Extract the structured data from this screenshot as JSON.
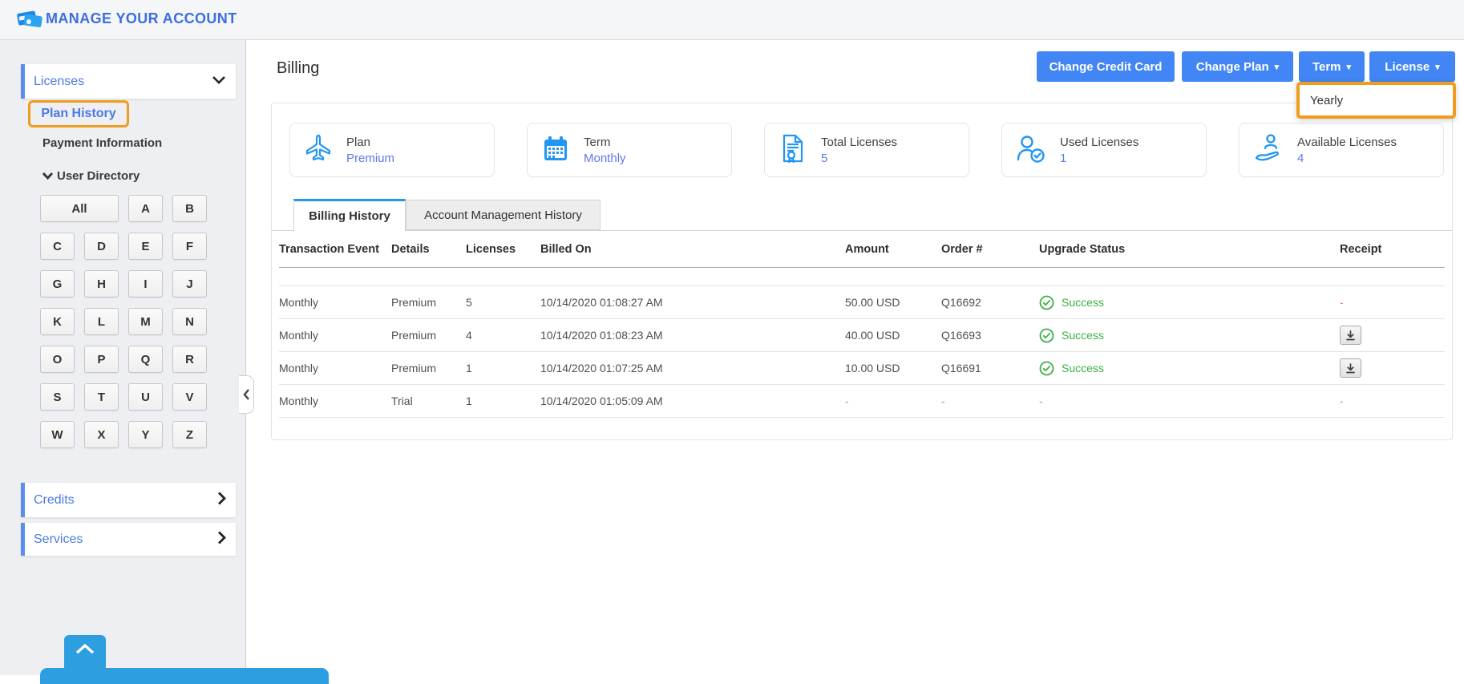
{
  "header": {
    "title": "MANAGE YOUR ACCOUNT"
  },
  "sidebar": {
    "licenses_label": "Licenses",
    "plan_history_label": "Plan History",
    "payment_information_label": "Payment Information",
    "user_directory_label": "User Directory",
    "letters": [
      "All",
      "A",
      "B",
      "C",
      "D",
      "E",
      "F",
      "G",
      "H",
      "I",
      "J",
      "K",
      "L",
      "M",
      "N",
      "O",
      "P",
      "Q",
      "R",
      "S",
      "T",
      "U",
      "V",
      "W",
      "X",
      "Y",
      "Z"
    ],
    "credits_label": "Credits",
    "services_label": "Services"
  },
  "main": {
    "title": "Billing",
    "buttons": {
      "change_credit_card": "Change Credit Card",
      "change_plan": "Change Plan",
      "term": "Term",
      "license": "License"
    },
    "term_dropdown": {
      "options": [
        "Yearly"
      ],
      "highlighted": true
    },
    "cards": [
      {
        "icon": "plane-icon",
        "label": "Plan",
        "value": "Premium"
      },
      {
        "icon": "calendar-icon",
        "label": "Term",
        "value": "Monthly"
      },
      {
        "icon": "license-doc-icon",
        "label": "Total Licenses",
        "value": "5"
      },
      {
        "icon": "user-check-icon",
        "label": "Used Licenses",
        "value": "1"
      },
      {
        "icon": "hand-user-icon",
        "label": "Available Licenses",
        "value": "4"
      }
    ],
    "tabs": [
      {
        "label": "Billing History",
        "active": true
      },
      {
        "label": "Account Management History",
        "active": false
      }
    ],
    "table": {
      "columns": [
        "Transaction Event",
        "Details",
        "Licenses",
        "Billed On",
        "Amount",
        "Order #",
        "Upgrade Status",
        "Receipt"
      ],
      "rows": [
        {
          "transaction_event": "Monthly",
          "details": "Premium",
          "licenses": "5",
          "billed_on": "10/14/2020 01:08:27 AM",
          "amount": "50.00 USD",
          "order": "Q16692",
          "status": "Success",
          "receipt": "-"
        },
        {
          "transaction_event": "Monthly",
          "details": "Premium",
          "licenses": "4",
          "billed_on": "10/14/2020 01:08:23 AM",
          "amount": "40.00 USD",
          "order": "Q16693",
          "status": "Success",
          "receipt": "download"
        },
        {
          "transaction_event": "Monthly",
          "details": "Premium",
          "licenses": "1",
          "billed_on": "10/14/2020 01:07:25 AM",
          "amount": "10.00 USD",
          "order": "Q16691",
          "status": "Success",
          "receipt": "download"
        },
        {
          "transaction_event": "Monthly",
          "details": "Trial",
          "licenses": "1",
          "billed_on": "10/14/2020 01:05:09 AM",
          "amount": "-",
          "order": "-",
          "status": "-",
          "receipt": "-"
        }
      ]
    }
  },
  "colors": {
    "accent_blue": "#4285f4",
    "link_blue": "#4b79e4",
    "value_blue": "#5d78e8",
    "icon_blue": "#2196f3",
    "highlight_orange": "#f09c1e",
    "success_green": "#3cb043",
    "dash_red": "#e88484",
    "bottom_blue": "#2d9fe0",
    "sidebar_bg": "#edeff3"
  }
}
